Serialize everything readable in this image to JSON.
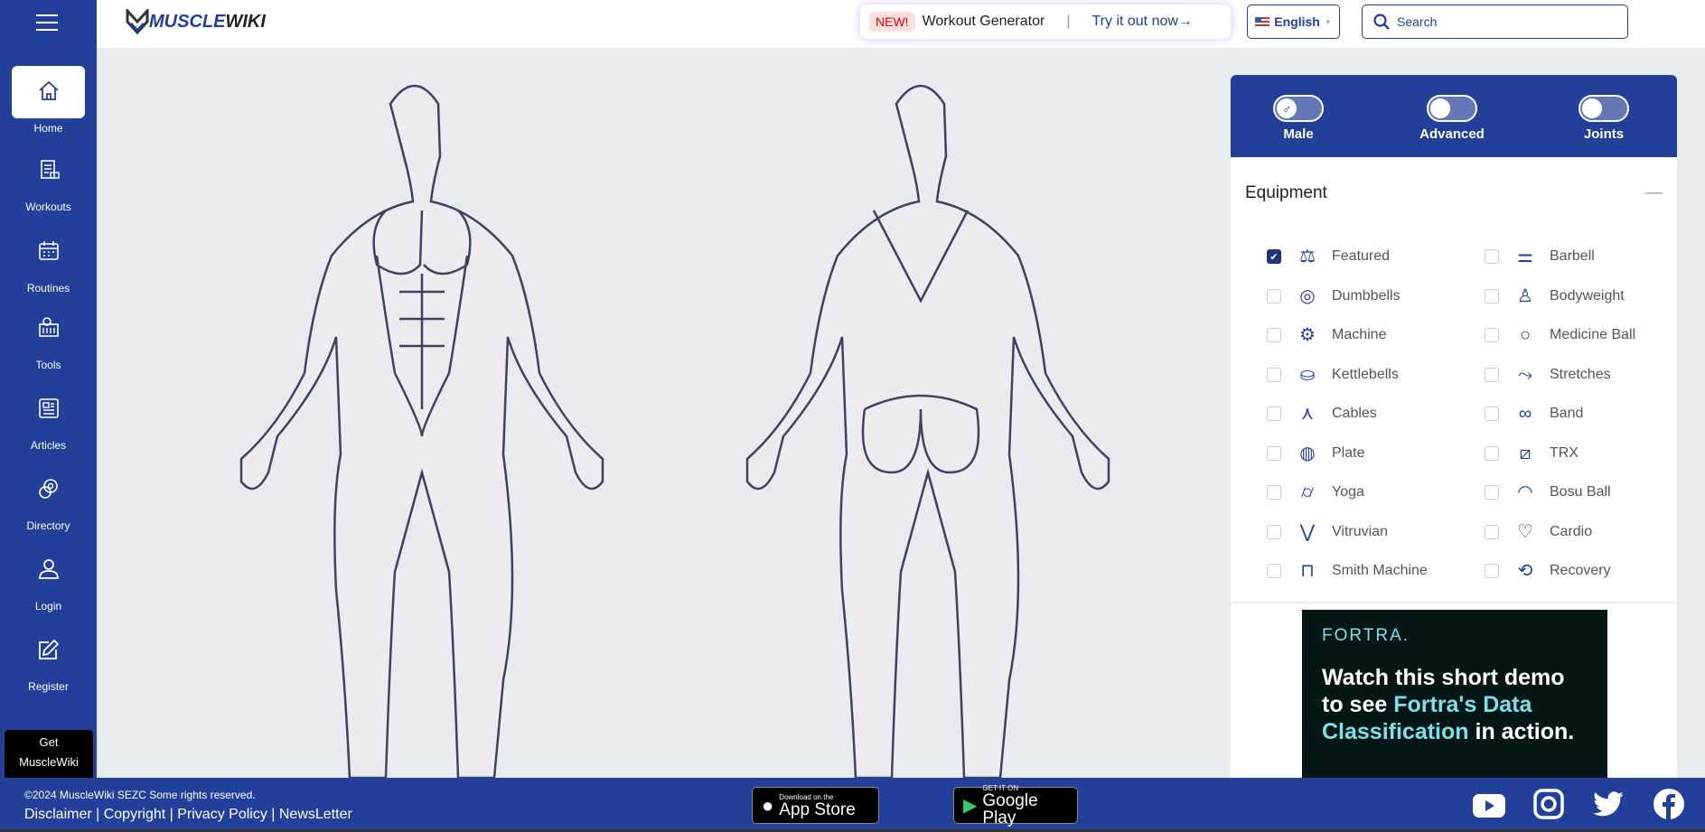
{
  "colors": {
    "brand": "#22409a",
    "checkbox": "#1f3577",
    "ad_accent": "#7ee0e6"
  },
  "header": {
    "logo_part1": "MUSCLE",
    "logo_part2": "WIKI",
    "promo": {
      "badge": "NEW!",
      "title": "Workout Generator",
      "cta": "Try it out now→"
    },
    "language": "English",
    "search_placeholder": "Search"
  },
  "sidebar": {
    "items": [
      {
        "label": "Home",
        "icon": "home-icon"
      },
      {
        "label": "Workouts",
        "icon": "clipboard-icon"
      },
      {
        "label": "Routines",
        "icon": "calendar-icon"
      },
      {
        "label": "Tools",
        "icon": "tools-icon"
      },
      {
        "label": "Articles",
        "icon": "newspaper-icon"
      },
      {
        "label": "Directory",
        "icon": "directory-icon"
      },
      {
        "label": "Login",
        "icon": "user-icon"
      },
      {
        "label": "Register",
        "icon": "edit-icon"
      }
    ],
    "get_app": [
      "Get",
      "MuscleWiki"
    ]
  },
  "panel": {
    "toggles": [
      {
        "label": "Male",
        "on": false
      },
      {
        "label": "Advanced",
        "on": false
      },
      {
        "label": "Joints",
        "on": false
      }
    ],
    "equipment_title": "Equipment",
    "collapse": "—",
    "equipment": [
      {
        "label": "Featured",
        "checked": true,
        "icon": "⚖"
      },
      {
        "label": "Barbell",
        "checked": false,
        "icon": "⚌"
      },
      {
        "label": "Dumbbells",
        "checked": false,
        "icon": "◎"
      },
      {
        "label": "Bodyweight",
        "checked": false,
        "icon": "♙"
      },
      {
        "label": "Machine",
        "checked": false,
        "icon": "⚙"
      },
      {
        "label": "Medicine Ball",
        "checked": false,
        "icon": "○"
      },
      {
        "label": "Kettlebells",
        "checked": false,
        "icon": "⛀"
      },
      {
        "label": "Stretches",
        "checked": false,
        "icon": "⤳"
      },
      {
        "label": "Cables",
        "checked": false,
        "icon": "⋏"
      },
      {
        "label": "Band",
        "checked": false,
        "icon": "∞"
      },
      {
        "label": "Plate",
        "checked": false,
        "icon": "◍"
      },
      {
        "label": "TRX",
        "checked": false,
        "icon": "⧄"
      },
      {
        "label": "Yoga",
        "checked": false,
        "icon": "⌭"
      },
      {
        "label": "Bosu Ball",
        "checked": false,
        "icon": "◠"
      },
      {
        "label": "Vitruvian",
        "checked": false,
        "icon": "⋁"
      },
      {
        "label": "Cardio",
        "checked": false,
        "icon": "♡"
      },
      {
        "label": "Smith Machine",
        "checked": false,
        "icon": "⊓"
      },
      {
        "label": "Recovery",
        "checked": false,
        "icon": "⟲"
      }
    ]
  },
  "ad": {
    "brand": "FORTRA.",
    "line1": "Watch this short demo to see ",
    "highlight": "Fortra's Data Classification",
    "line2": " in action."
  },
  "footer": {
    "copyright": "©2024 MuscleWiki SEZC Some rights reserved.",
    "links": [
      "Disclaimer",
      "Copyright",
      "Privacy Policy",
      "NewsLetter"
    ],
    "app_store": {
      "small": "Download on the",
      "big": "App Store"
    },
    "google_play": {
      "small": "GET IT ON",
      "big": "Google Play"
    },
    "social": [
      "youtube-icon",
      "instagram-icon",
      "twitter-icon",
      "facebook-icon"
    ]
  }
}
